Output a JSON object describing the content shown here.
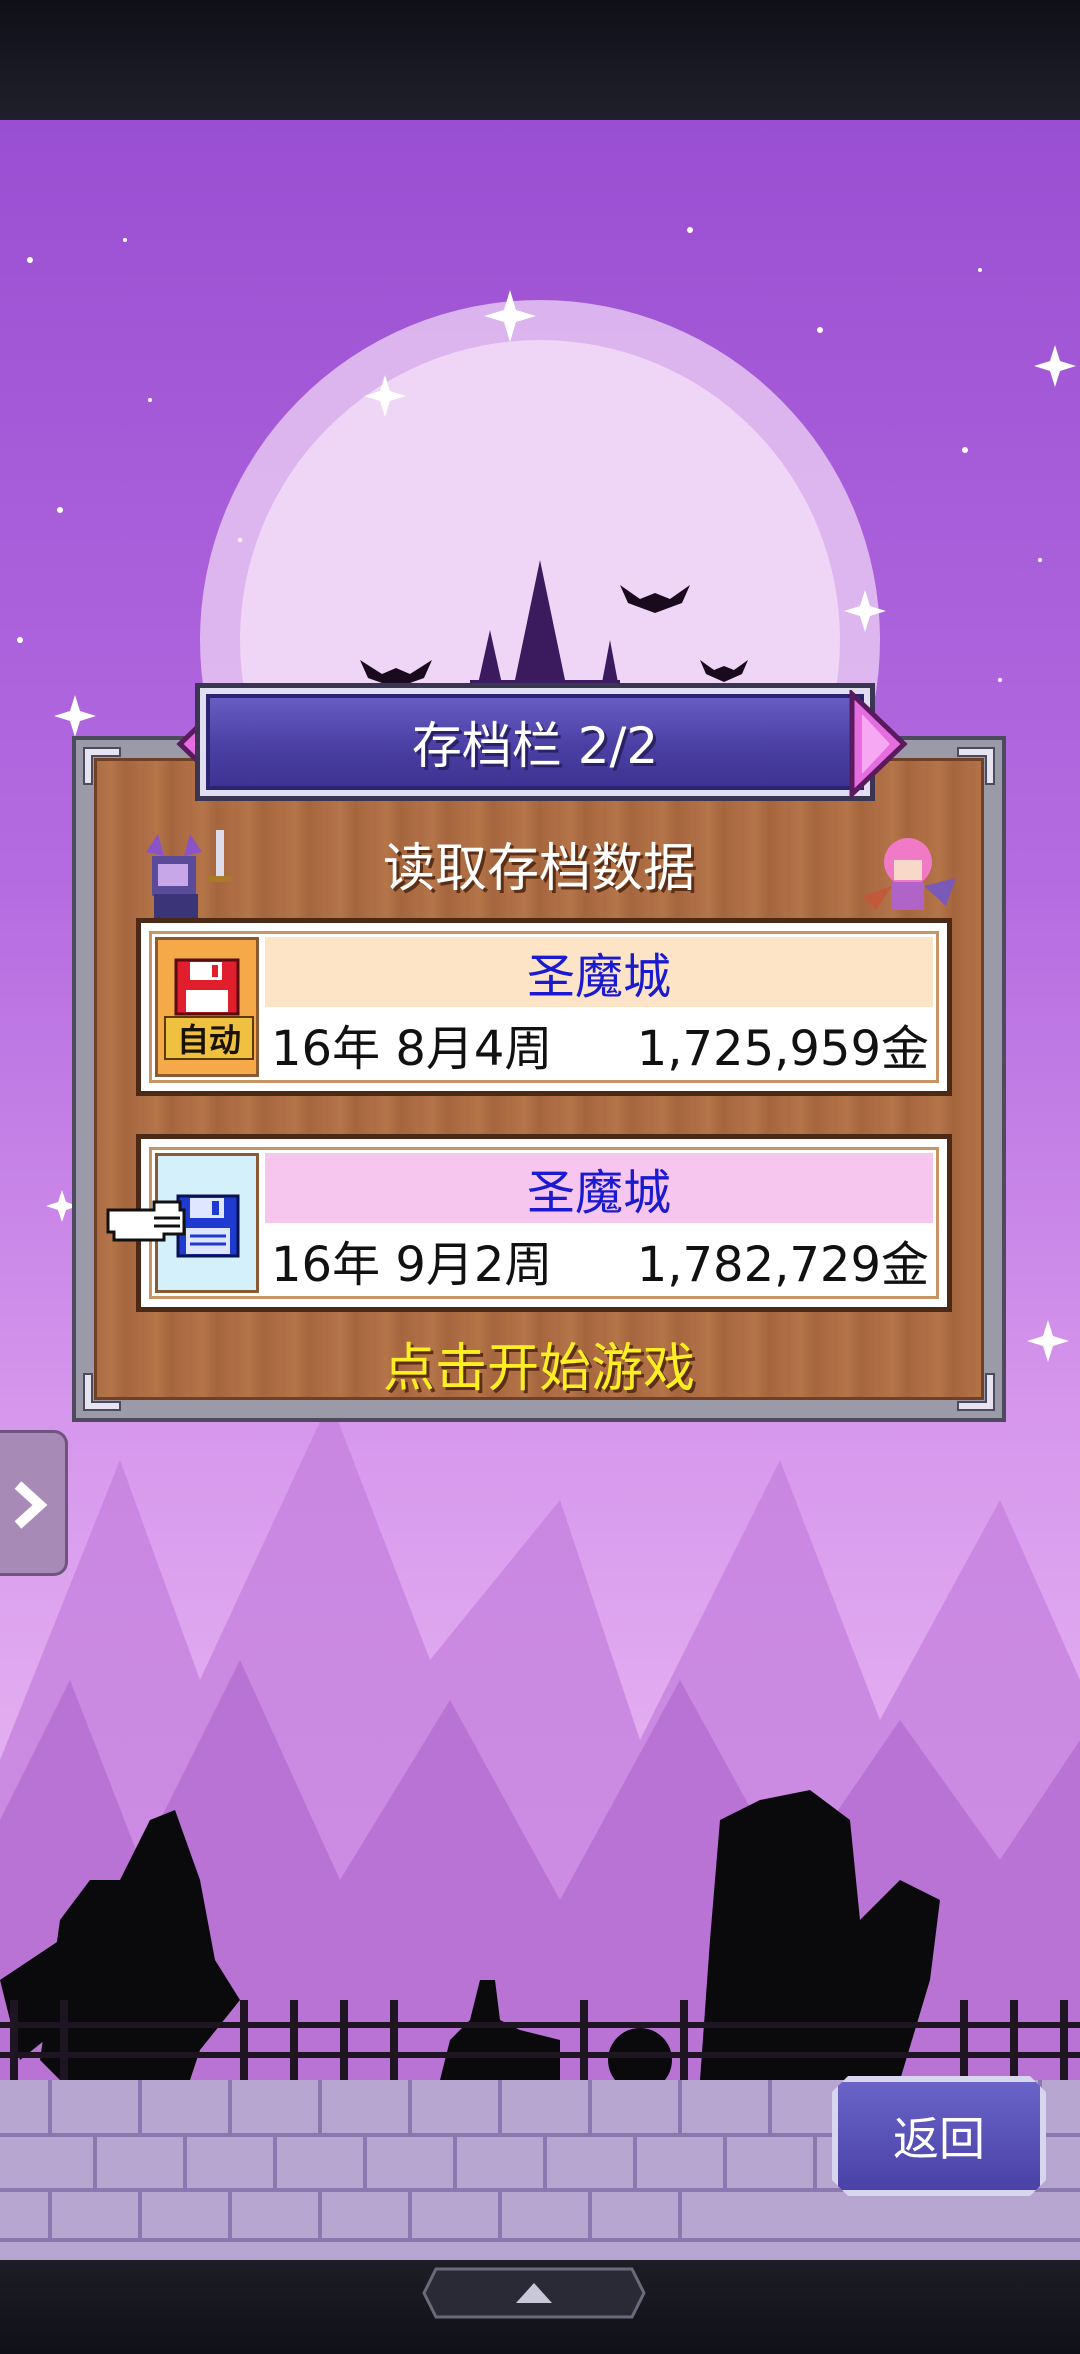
{
  "header": {
    "title": "存档栏 2/2",
    "subtitle": "读取存档数据"
  },
  "slots": [
    {
      "badge": "自动",
      "name": "圣魔城",
      "date": "16年 8月4周",
      "gold": "1,725,959金",
      "icon": "floppy-disk-red-icon"
    },
    {
      "name": "圣魔城",
      "date": "16年 9月2周",
      "gold": "1,782,729金",
      "icon": "floppy-disk-blue-icon",
      "selected": true
    }
  ],
  "start_prompt": "点击开始游戏",
  "buttons": {
    "back": "返回"
  },
  "colors": {
    "title_plate": "#4b3fa4",
    "slot_name": "#1a1ad0",
    "start_text": "#ffee22",
    "slot1_band": "#fde4c6",
    "slot2_band": "#f6c6ee"
  }
}
